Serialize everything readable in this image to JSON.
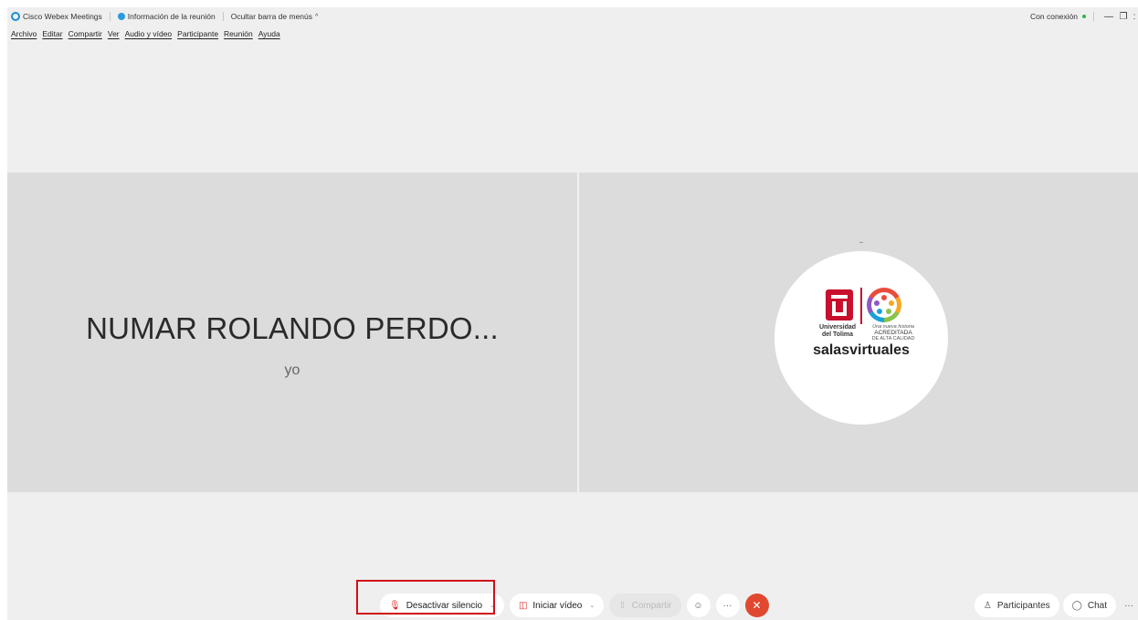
{
  "titlebar": {
    "app_name": "Cisco Webex Meetings",
    "meeting_info": "Información de la reunión",
    "hide_menu": "Ocultar barra de menús",
    "status": "Con conexión"
  },
  "menubar": [
    "Archivo",
    "Editar",
    "Compartir",
    "Ver",
    "Audio y vídeo",
    "Participante",
    "Reunión",
    "Ayuda"
  ],
  "tiles": {
    "local": {
      "name": "NUMAR ROLANDO PERDO...",
      "sub": "yo"
    },
    "remote": {
      "logo_left_line1": "Universidad",
      "logo_left_line2": "del Tolima",
      "logo_right_line1": "Una nueva historia",
      "logo_right_line2": "ACREDITADA",
      "logo_right_line3": "DE ALTA CALIDAD",
      "brand": "salasvirtuales"
    }
  },
  "controls": {
    "mute": "Desactivar silencio",
    "video": "Iniciar vídeo",
    "share": "Compartir"
  },
  "side_controls": {
    "participants": "Participantes",
    "chat": "Chat"
  },
  "colors": {
    "accent": "#1a8dd8",
    "end_call": "#e0492f",
    "highlight": "#d0101a",
    "status_connected": "#2fb34a"
  }
}
